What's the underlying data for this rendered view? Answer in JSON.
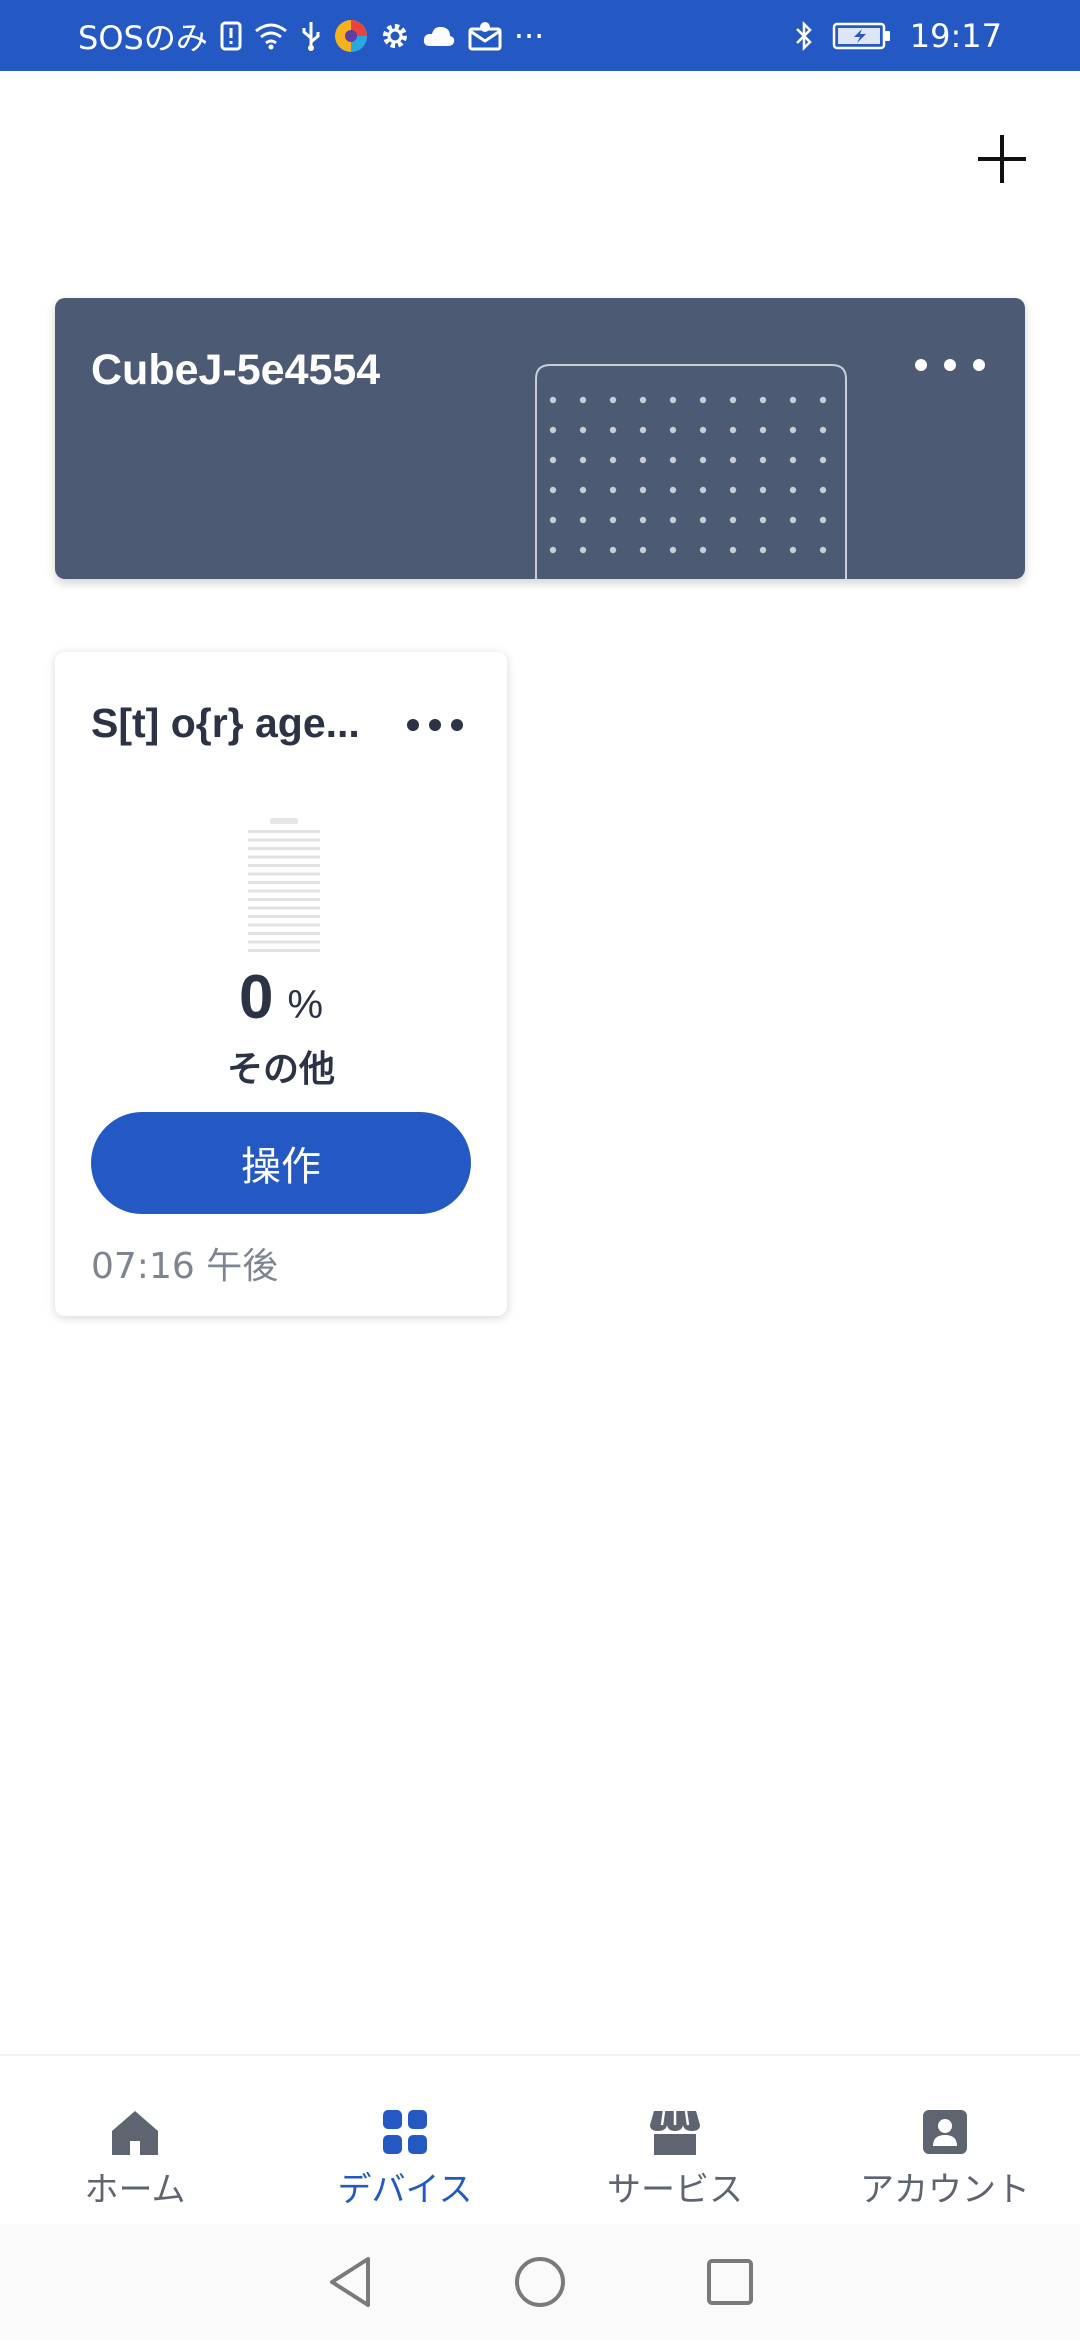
{
  "status_bar": {
    "carrier": "SOSのみ",
    "overflow_indicator": "···",
    "time": "19:17",
    "icons": [
      "sim-alert-icon",
      "wifi-icon",
      "usb-icon",
      "browser-app-icon",
      "gear-icon",
      "cloud-icon",
      "mail-icon",
      "bluetooth-icon",
      "battery-charging-icon"
    ]
  },
  "header": {
    "add_icon": "plus-icon"
  },
  "hub_card": {
    "title": "CubeJ-5e4554",
    "more_icon": "more-horizontal-icon",
    "graphic_icon": "hub-device-icon"
  },
  "device_card": {
    "name": "S[t] o{r} age...",
    "more_icon": "more-horizontal-icon",
    "battery_level": 0,
    "percent_value": "0",
    "percent_unit": "%",
    "status_label": "その他",
    "operate_label": "操作",
    "timestamp": "07:16 午後"
  },
  "bottom_nav": {
    "active": "devices",
    "items": [
      {
        "key": "home",
        "label": "ホーム",
        "icon": "home-icon"
      },
      {
        "key": "devices",
        "label": "デバイス",
        "icon": "grid-icon"
      },
      {
        "key": "services",
        "label": "サービス",
        "icon": "store-icon"
      },
      {
        "key": "account",
        "label": "アカウント",
        "icon": "account-icon"
      }
    ]
  },
  "colors": {
    "primary": "#2459c4",
    "hub_card_bg": "#4d5a73",
    "text_dark": "#2b3344",
    "text_muted": "#7f8590"
  }
}
